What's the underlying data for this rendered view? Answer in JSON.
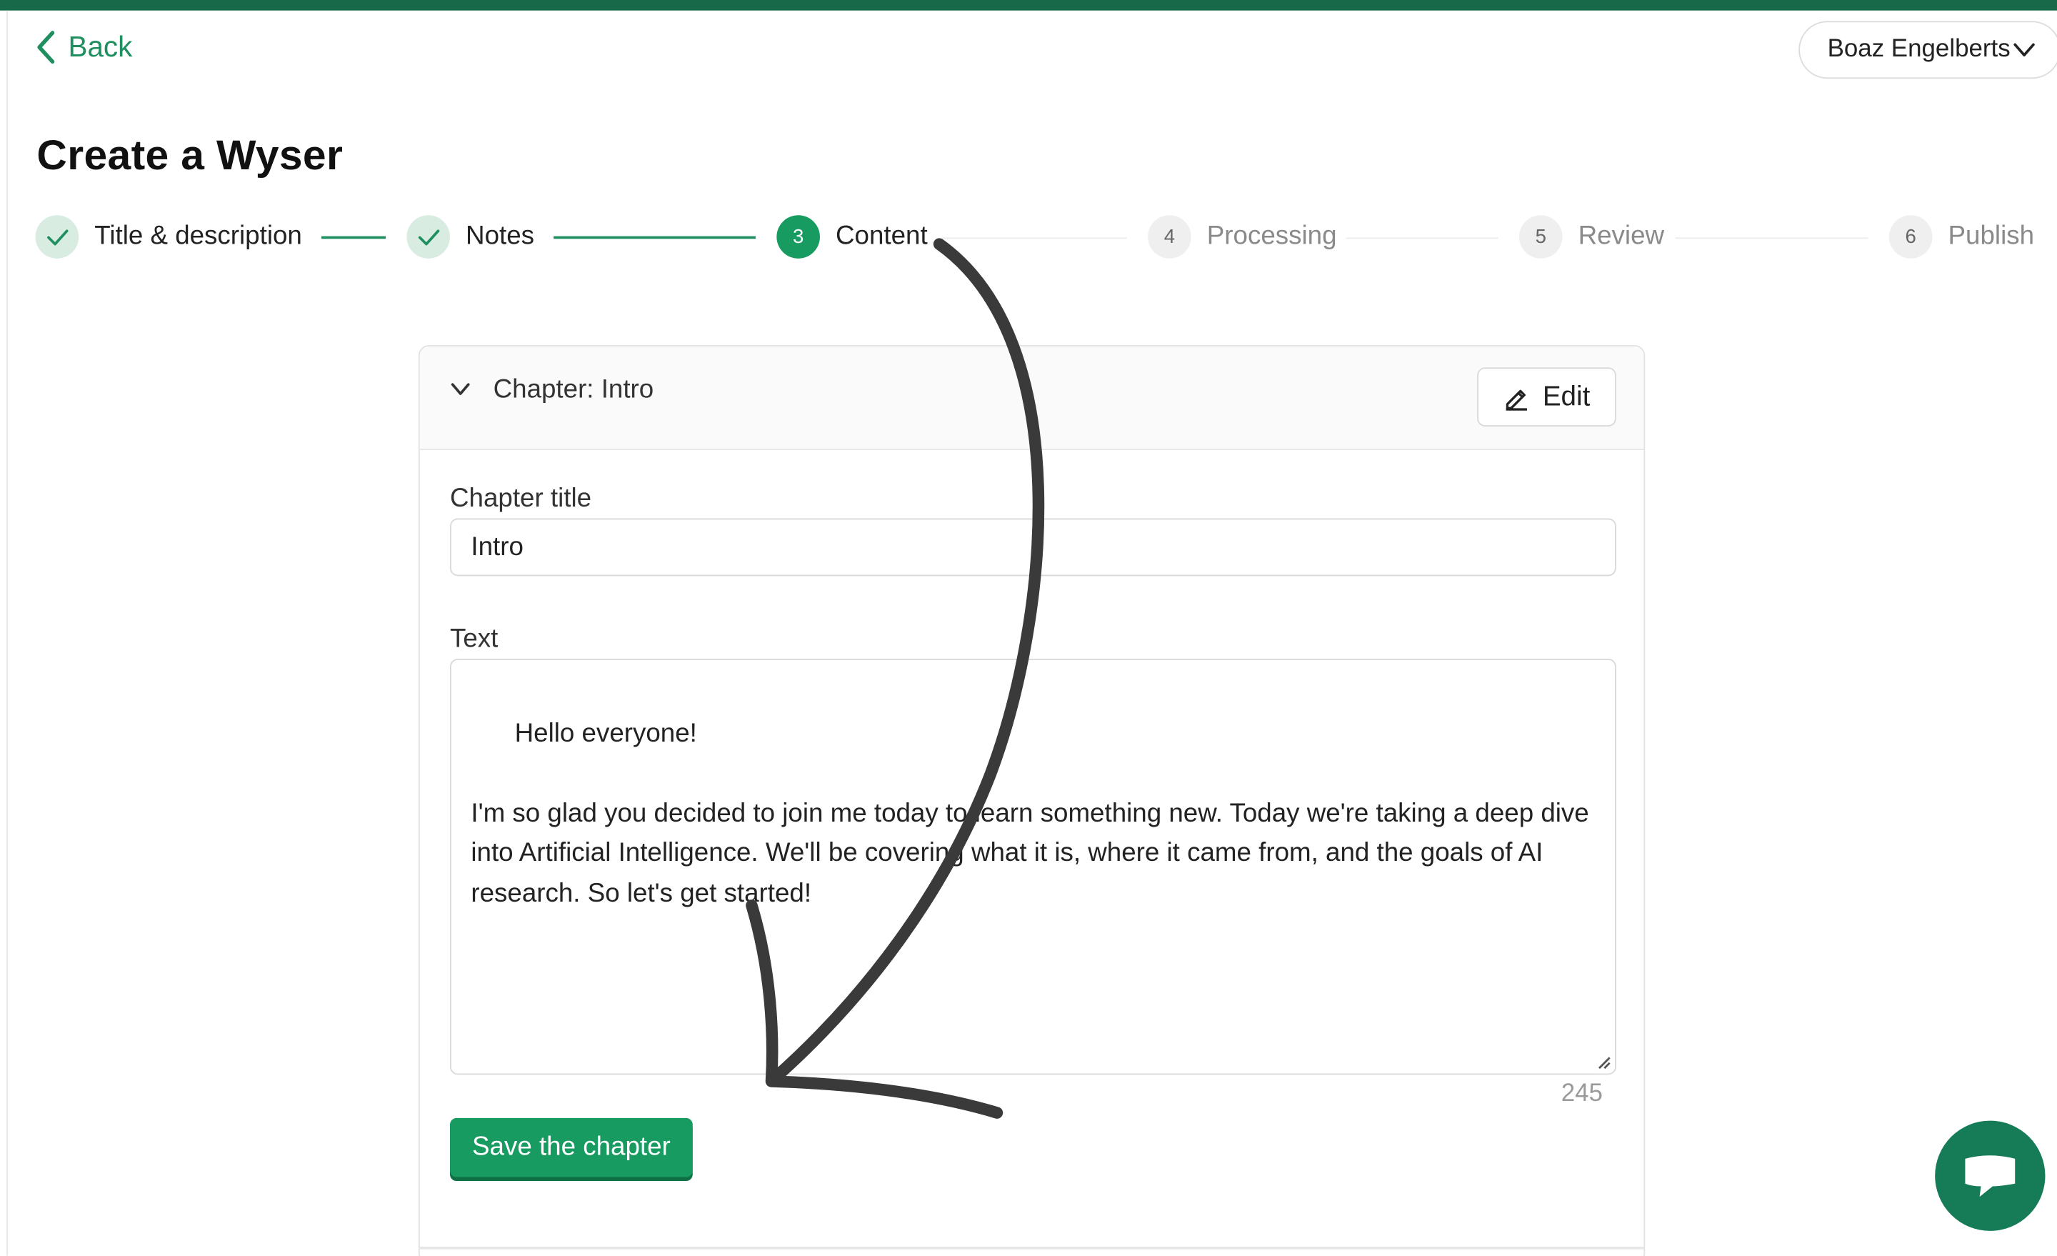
{
  "header": {
    "back_label": "Back",
    "user_name": "Boaz Engelberts"
  },
  "page": {
    "title": "Create a Wyser"
  },
  "stepper": {
    "steps": [
      {
        "number": "1",
        "label": "Title & description",
        "state": "done"
      },
      {
        "number": "2",
        "label": "Notes",
        "state": "done"
      },
      {
        "number": "3",
        "label": "Content",
        "state": "active"
      },
      {
        "number": "4",
        "label": "Processing",
        "state": "todo"
      },
      {
        "number": "5",
        "label": "Review",
        "state": "todo"
      },
      {
        "number": "6",
        "label": "Publish",
        "state": "todo"
      }
    ]
  },
  "chapter": {
    "header_label": "Chapter: Intro",
    "edit_label": "Edit",
    "title_label": "Chapter title",
    "title_value": "Intro",
    "text_label": "Text",
    "text_value": "Hello everyone!\n\nI'm so glad you decided to join me today to learn something new. Today we're taking a deep dive into Artificial Intelligence. We'll be covering what it is, where it came from, and the goals of AI research. So let's get started!",
    "char_count": "245",
    "save_label": "Save the chapter"
  },
  "colors": {
    "brand_green": "#179b61",
    "top_bar": "#17694a",
    "chat_button": "#157c57"
  },
  "icons": {
    "back": "chevron-left-icon",
    "user_menu": "chevron-down-icon",
    "step_done": "check-icon",
    "collapse": "chevron-down-icon",
    "edit": "pencil-icon",
    "chat": "chat-bubble-icon"
  },
  "annotation": {
    "type": "hand-drawn-arrow",
    "from": "Content step",
    "to": "Save the chapter button"
  }
}
